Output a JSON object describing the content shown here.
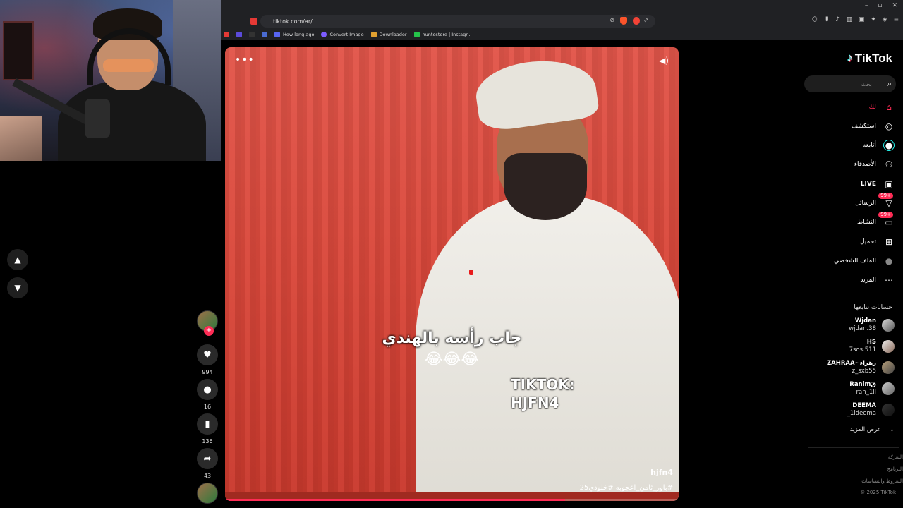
{
  "browser": {
    "url": "tiktok.com/ar/",
    "bookmarks": [
      {
        "label": "How long ago",
        "color": "#5865f2"
      },
      {
        "label": "Convert Image",
        "color": "#7c5cff"
      },
      {
        "label": "Downloader",
        "color": "#e0a030"
      },
      {
        "label": "huntostore | Instagr...",
        "color": "#25c24a"
      }
    ],
    "window_controls": [
      "–",
      "▫",
      "✕"
    ]
  },
  "video": {
    "caption_text": "جاب رأسه بالهندي",
    "caption_emoji": "😂😂😂",
    "watermark_line1": "TIKTOK:",
    "watermark_line2": "HJFN4",
    "author": "hjfn4",
    "description": "#باور_ثامن_اعجوبه #خلودي25",
    "progress": 0.75,
    "menu_icon": "more-icon",
    "sound_icon": "speaker-icon",
    "colors": {
      "background": "#d9473a",
      "accent": "#fe2c55"
    }
  },
  "actions": {
    "likes": "994",
    "comments": "16",
    "saves": "136",
    "shares": "43"
  },
  "sidebar": {
    "brand": "TikTok",
    "search_placeholder": "بحث",
    "nav": [
      {
        "label": "لك",
        "icon": "home-icon",
        "badge": "",
        "active": true
      },
      {
        "label": "استكشف",
        "icon": "compass-icon",
        "badge": "",
        "active": false
      },
      {
        "label": "أتابعه",
        "icon": "following-icon",
        "badge": "",
        "active": false
      },
      {
        "label": "الأصدقاء",
        "icon": "friends-icon",
        "badge": "",
        "active": false
      },
      {
        "label": "LIVE",
        "icon": "live-icon",
        "badge": "",
        "active": false
      },
      {
        "label": "الرسائل",
        "icon": "messages-icon",
        "badge": "99+",
        "active": false
      },
      {
        "label": "النشاط",
        "icon": "activity-icon",
        "badge": "99+",
        "active": false
      },
      {
        "label": "تحميل",
        "icon": "upload-icon",
        "badge": "",
        "active": false
      },
      {
        "label": "الملف الشخصي",
        "icon": "profile-icon",
        "badge": "",
        "active": false
      },
      {
        "label": "المزيد",
        "icon": "more-icon",
        "badge": "",
        "active": false
      }
    ],
    "following_title": "حسابات تتابعها",
    "accounts": [
      {
        "name": "Wjdan",
        "handle": "wjdan.38"
      },
      {
        "name": "HS",
        "handle": "7sos.511"
      },
      {
        "name": "ZAHRAA~زهراء",
        "handle": "z_sxb55"
      },
      {
        "name": "Ranimقَ",
        "handle": "ran_1ll"
      },
      {
        "name": "DEEMA",
        "handle": "_1ideema"
      }
    ],
    "show_more": "عرض المزيد",
    "footer": [
      "الشركة",
      "البرنامج",
      "الشروط والسياسات",
      "© 2025 TikTok"
    ]
  }
}
